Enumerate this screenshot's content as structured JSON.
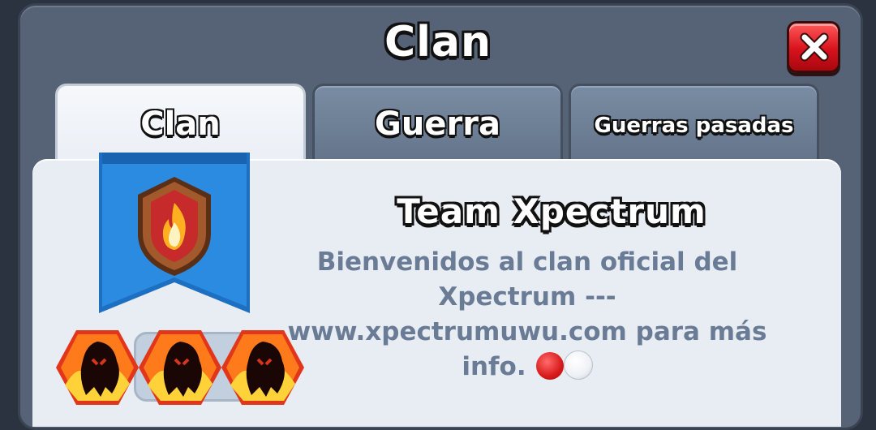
{
  "window": {
    "title": "Clan"
  },
  "tabs": [
    {
      "label": "Clan",
      "active": true
    },
    {
      "label": "Guerra",
      "active": false
    },
    {
      "label": "Guerras pasadas",
      "active": false
    }
  ],
  "clan": {
    "name": "Team Xpectrum",
    "description": "Bienvenidos al clan oficial del Xpectrum --- www.xpectrumuwu.com para más info."
  },
  "icons": {
    "close": "close-x-icon",
    "badge": "fire-shield-icon",
    "avatars": [
      "fire-ghost-icon",
      "fire-ghost-icon",
      "fire-ghost-icon"
    ],
    "status_dots": [
      "red-circle-icon",
      "white-circle-icon"
    ]
  },
  "colors": {
    "frame": "#566376",
    "banner": "#2a8be0",
    "close": "#d8121d",
    "description": "#6a7b95"
  }
}
